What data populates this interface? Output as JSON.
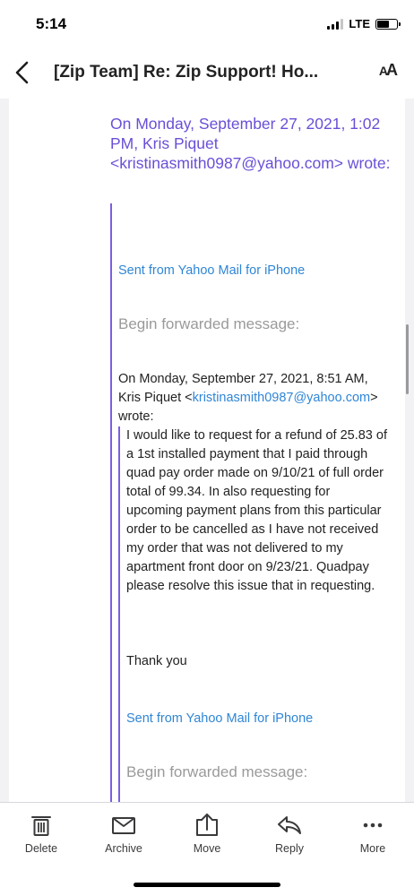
{
  "status_bar": {
    "time": "5:14",
    "network": "LTE",
    "signal_bars": 3,
    "battery_level": 0.6
  },
  "nav": {
    "back_icon": "chevron-left-icon",
    "title": "[Zip Team] Re: Zip Support! Ho...",
    "font_size_label_big": "A",
    "font_size_label_small": "A"
  },
  "email": {
    "quote_header": {
      "prefix": "On Monday, September 27, 2021, 1:02 PM, Kris Piquet <",
      "email": "kristinasmith0987@yahoo.com",
      "suffix": "> wrote:"
    },
    "sent_from_1": "Sent from Yahoo Mail for iPhone",
    "forwarded_1": "Begin forwarded message:",
    "inner_header": {
      "prefix": "On Monday, September 27, 2021, 8:51 AM, Kris Piquet <",
      "email": "kristinasmith0987@yahoo.com",
      "suffix": "> wrote:"
    },
    "body": "I would like to request for a refund of 25.83 of a 1st installed payment that I paid through quad pay order made on 9/10/21 of full order total of 99.34. In also requesting for upcoming payment plans from this particular order to be cancelled as I have not received my order that was not delivered to my apartment front door on 9/23/21. Quadpay please resolve this issue that in requesting.",
    "thanks": "Thank you",
    "sent_from_2": "Sent from Yahoo Mail for iPhone",
    "forwarded_2": "Begin forwarded message:"
  },
  "toolbar": {
    "delete_label": "Delete",
    "archive_label": "Archive",
    "move_label": "Move",
    "reply_label": "Reply",
    "more_label": "More"
  },
  "colors": {
    "quote_purple": "#6a4fd6",
    "link_blue": "#2f86d6",
    "muted_gray": "#9a9a9a"
  }
}
